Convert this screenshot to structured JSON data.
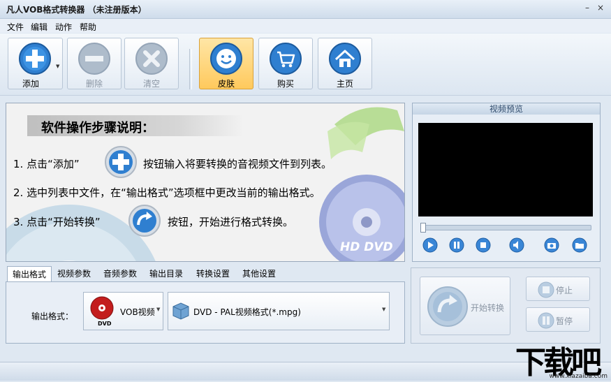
{
  "window": {
    "title": "凡人VOB格式转换器 （未注册版本）",
    "minimize": "–",
    "close": "×"
  },
  "menu": [
    "文件",
    "编辑",
    "动作",
    "帮助"
  ],
  "toolbar": {
    "add": "添加",
    "delete": "删除",
    "clear": "清空",
    "skin": "皮肤",
    "buy": "购买",
    "home": "主页"
  },
  "guide": {
    "title": "软件操作步骤说明：",
    "step1_a": "1. 点击“添加”",
    "step1_b": "按钮输入将要转换的音视频文件到列表。",
    "step2": "2. 选中列表中文件，在“输出格式”选项框中更改当前的输出格式。",
    "step3_a": "3. 点击“开始转换”",
    "step3_b": "按钮，开始进行格式转换。",
    "disc_label": "HD DVD"
  },
  "preview": {
    "title": "视频预览"
  },
  "tabs": [
    "输出格式",
    "视频参数",
    "音频参数",
    "输出目录",
    "转换设置",
    "其他设置"
  ],
  "output": {
    "label": "输出格式：",
    "category": "VOB视频",
    "category_icon_text": "DVD",
    "format": "DVD - PAL视频格式(*.mpg)"
  },
  "controls": {
    "start": "开始转换",
    "stop": "停止",
    "pause": "暂停"
  },
  "watermark": {
    "text": "下载吧",
    "url": "www.xiazaiba.com"
  },
  "colors": {
    "accent_blue": "#2f7fd0",
    "skin_active": "#ffc95c"
  }
}
